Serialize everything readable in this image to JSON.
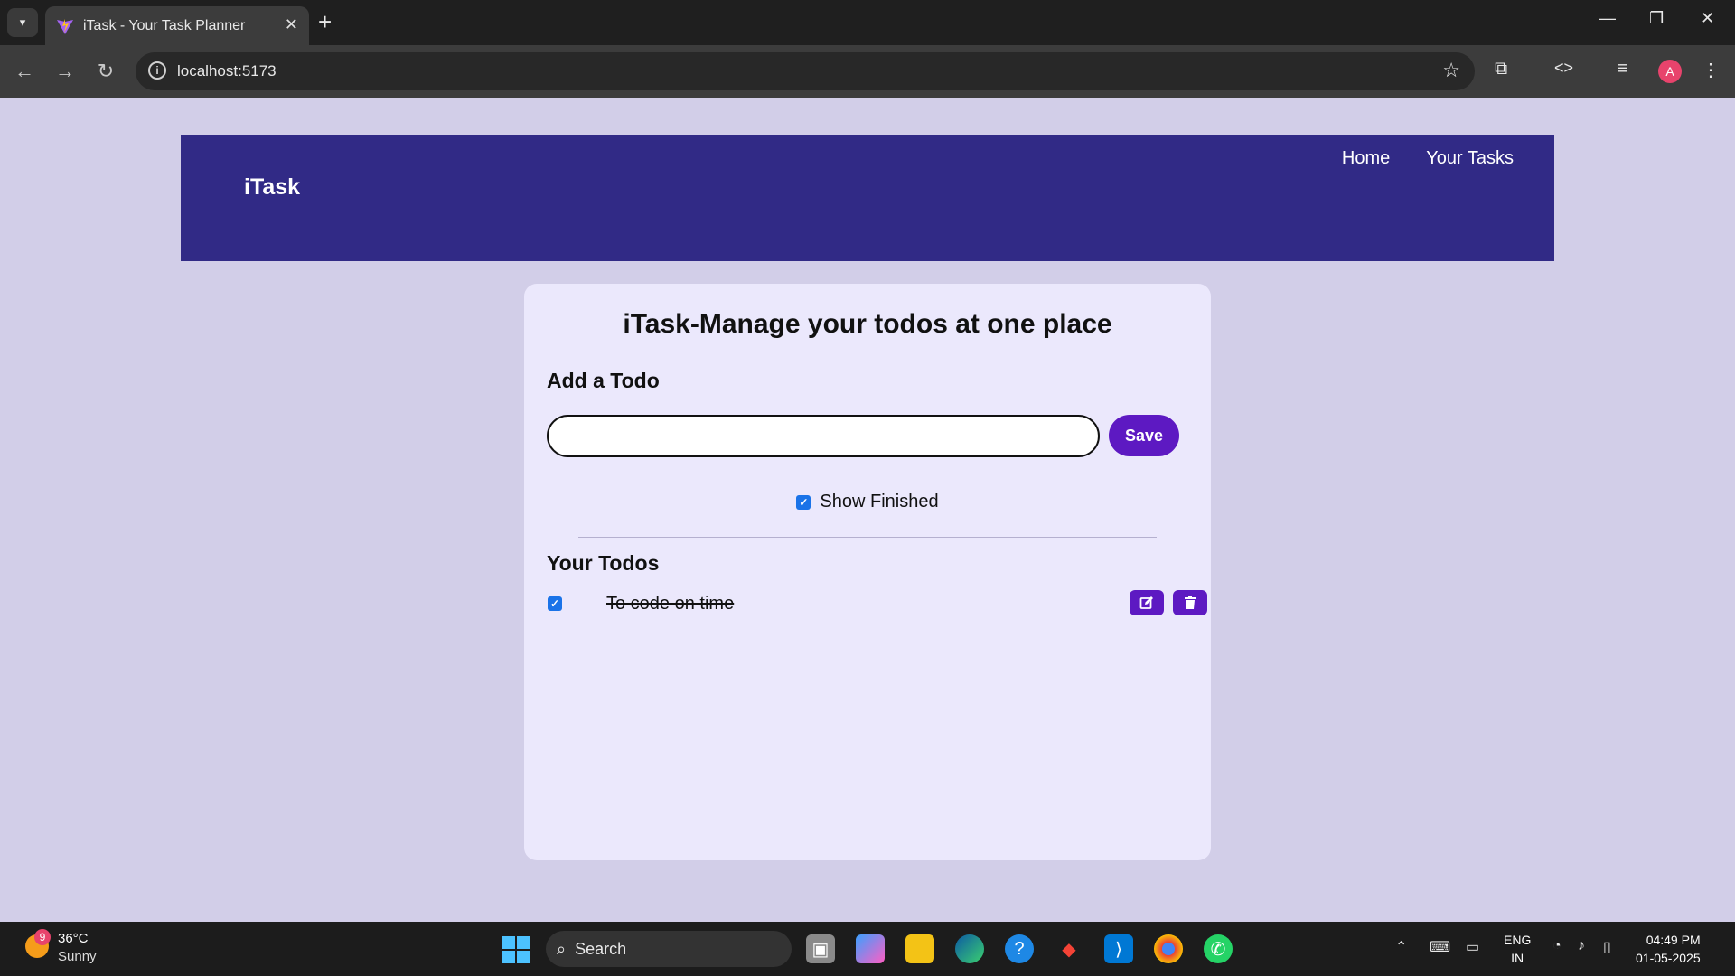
{
  "browser": {
    "tab_title": "iTask - Your Task Planner",
    "url": "localhost:5173",
    "avatar_letter": "A"
  },
  "navbar": {
    "brand": "iTask",
    "links": [
      "Home",
      "Your Tasks"
    ]
  },
  "card": {
    "title": "iTask-Manage your todos at one place",
    "add_heading": "Add a Todo",
    "input_value": "",
    "save_label": "Save",
    "show_finished_label": "Show Finished",
    "show_finished_checked": true,
    "todos_heading": "Your Todos",
    "todos": [
      {
        "text": "To code on time",
        "completed": true
      }
    ]
  },
  "taskbar": {
    "weather_badge": "9",
    "temperature": "36°C",
    "condition": "Sunny",
    "search_label": "Search",
    "language": "ENG",
    "region": "IN",
    "time": "04:49 PM",
    "date": "01-05-2025"
  },
  "colors": {
    "page_bg": "#d2cee8",
    "navbar_bg": "#312a86",
    "card_bg": "#ebe8fc",
    "accent": "#5d19c2"
  }
}
